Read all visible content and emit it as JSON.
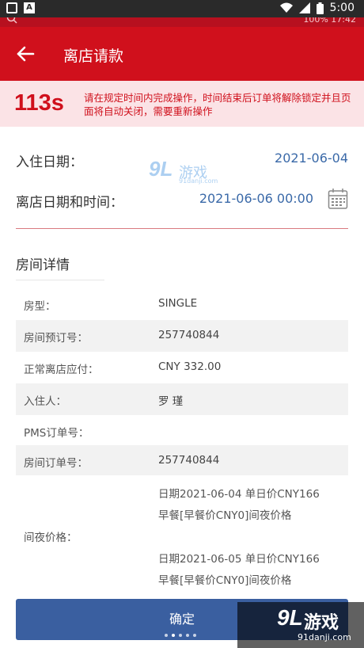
{
  "status_bar": {
    "time": "5:00",
    "icons": [
      "notification-box-icon",
      "a-app-icon",
      "wifi-icon",
      "signal-icon",
      "battery-icon"
    ]
  },
  "ghost_bar": {
    "left_icon": "search-icon",
    "right_text": "100% 17:42"
  },
  "header": {
    "title": "离店请款",
    "back_icon": "back-arrow-icon"
  },
  "timer": {
    "count": "113s",
    "message": "请在规定时间内完成操作，时间结束后订单将解除锁定并且页面将自动关闭，需要重新操作"
  },
  "checkin": {
    "label": "入住日期：",
    "value": "2021-06-04"
  },
  "checkout": {
    "label": "离店日期和时间：",
    "value": "2021-06-06 00:00",
    "icon": "calendar-icon"
  },
  "room_details": {
    "title": "房间详情",
    "rows": [
      {
        "label": "房型：",
        "value": "SINGLE"
      },
      {
        "label": "房间预订号：",
        "value": "257740844"
      },
      {
        "label": "正常离店应付：",
        "value": "CNY 332.00"
      },
      {
        "label": "入住人：",
        "value": "罗 瑾"
      },
      {
        "label": "PMS订单号：",
        "value": ""
      },
      {
        "label": "房间订单号：",
        "value": "257740844"
      }
    ],
    "night_price": {
      "label": "间夜价格：",
      "lines": [
        "日期2021-06-04 单日价CNY166",
        "早餐[早餐价CNY0]间夜价格",
        "日期2021-06-05 单日价CNY166",
        "早餐[早餐价CNY0]间夜价格"
      ]
    }
  },
  "confirm_button": {
    "label": "确定"
  },
  "watermark": {
    "mark": "9L",
    "text": "游戏",
    "url": "91danji.com",
    "url_small": "91danji.com"
  },
  "colors": {
    "brand_red": "#d0101c",
    "banner_pink": "#fbe3e6",
    "link_blue": "#3a69a8",
    "button_blue": "#3a5fa0"
  }
}
